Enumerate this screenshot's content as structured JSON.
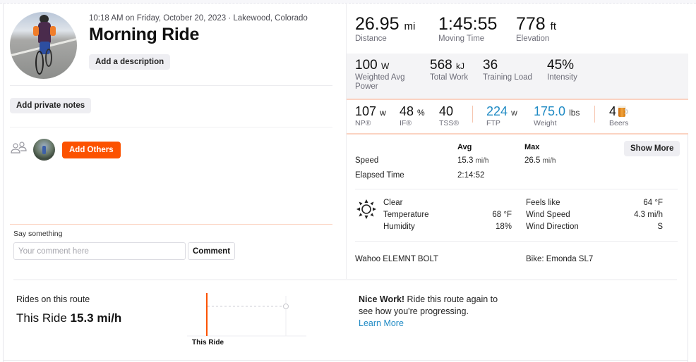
{
  "activity": {
    "meta": "10:18 AM on Friday, October 20, 2023 · Lakewood, Colorado",
    "title": "Morning Ride",
    "add_description_label": "Add a description",
    "add_private_notes_label": "Add private notes",
    "add_others_label": "Add Others"
  },
  "comment": {
    "label": "Say something",
    "placeholder": "Your comment here",
    "value": "",
    "button_label": "Comment"
  },
  "primary_stats": [
    {
      "value": "26.95",
      "unit": "mi",
      "label": "Distance"
    },
    {
      "value": "1:45:55",
      "unit": "",
      "label": "Moving Time"
    },
    {
      "value": "778",
      "unit": "ft",
      "label": "Elevation"
    }
  ],
  "power_stats": [
    {
      "value": "100",
      "unit": "W",
      "label": "Weighted Avg Power"
    },
    {
      "value": "568",
      "unit": "kJ",
      "label": "Total Work"
    },
    {
      "value": "36",
      "unit": "",
      "label": "Training Load"
    },
    {
      "value": "45%",
      "unit": "",
      "label": "Intensity"
    }
  ],
  "extra_stats": [
    {
      "value": "107",
      "unit": "w",
      "label": "NP®"
    },
    {
      "value": "48",
      "unit": "%",
      "label": "IF®"
    },
    {
      "value": "40",
      "unit": "",
      "label": "TSS®"
    },
    {
      "value": "224",
      "unit": "w",
      "label": "FTP",
      "accent": true
    },
    {
      "value": "175.0",
      "unit": "lbs",
      "label": "Weight",
      "accent": true
    },
    {
      "value": "4",
      "unit": "",
      "label": "Beers",
      "icon": "beer-mug-icon"
    }
  ],
  "detail_table": {
    "headers": [
      "Avg",
      "Max"
    ],
    "rows": [
      {
        "label": "Speed",
        "avg": "15.3",
        "avg_unit": "mi/h",
        "max": "26.5",
        "max_unit": "mi/h"
      },
      {
        "label": "Elapsed Time",
        "avg": "2:14:52",
        "avg_unit": "",
        "max": "",
        "max_unit": ""
      }
    ],
    "show_more_label": "Show More"
  },
  "weather": {
    "icon": "sun-icon",
    "condition": "Clear",
    "left": [
      {
        "label": "Temperature",
        "value": "68 °F"
      },
      {
        "label": "Humidity",
        "value": "18%"
      }
    ],
    "right": [
      {
        "label": "Feels like",
        "value": "64 °F"
      },
      {
        "label": "Wind Speed",
        "value": "4.3 mi/h"
      },
      {
        "label": "Wind Direction",
        "value": "S"
      }
    ]
  },
  "gear": {
    "device": "Wahoo ELEMNT BOLT",
    "bike": "Bike: Emonda SL7"
  },
  "route": {
    "title": "Rides on this route",
    "value_prefix": "This Ride",
    "value": "15.3 mi/h",
    "chart_label": "This Ride",
    "accent_color": "#fc5200"
  },
  "nice_work": {
    "bold": "Nice Work!",
    "text": " Ride this route again to see how you're progressing.",
    "link": "Learn More"
  },
  "colors": {
    "brand": "#fc5200",
    "link": "#1f8ac4",
    "divider_accent": "#fbd3c2"
  }
}
